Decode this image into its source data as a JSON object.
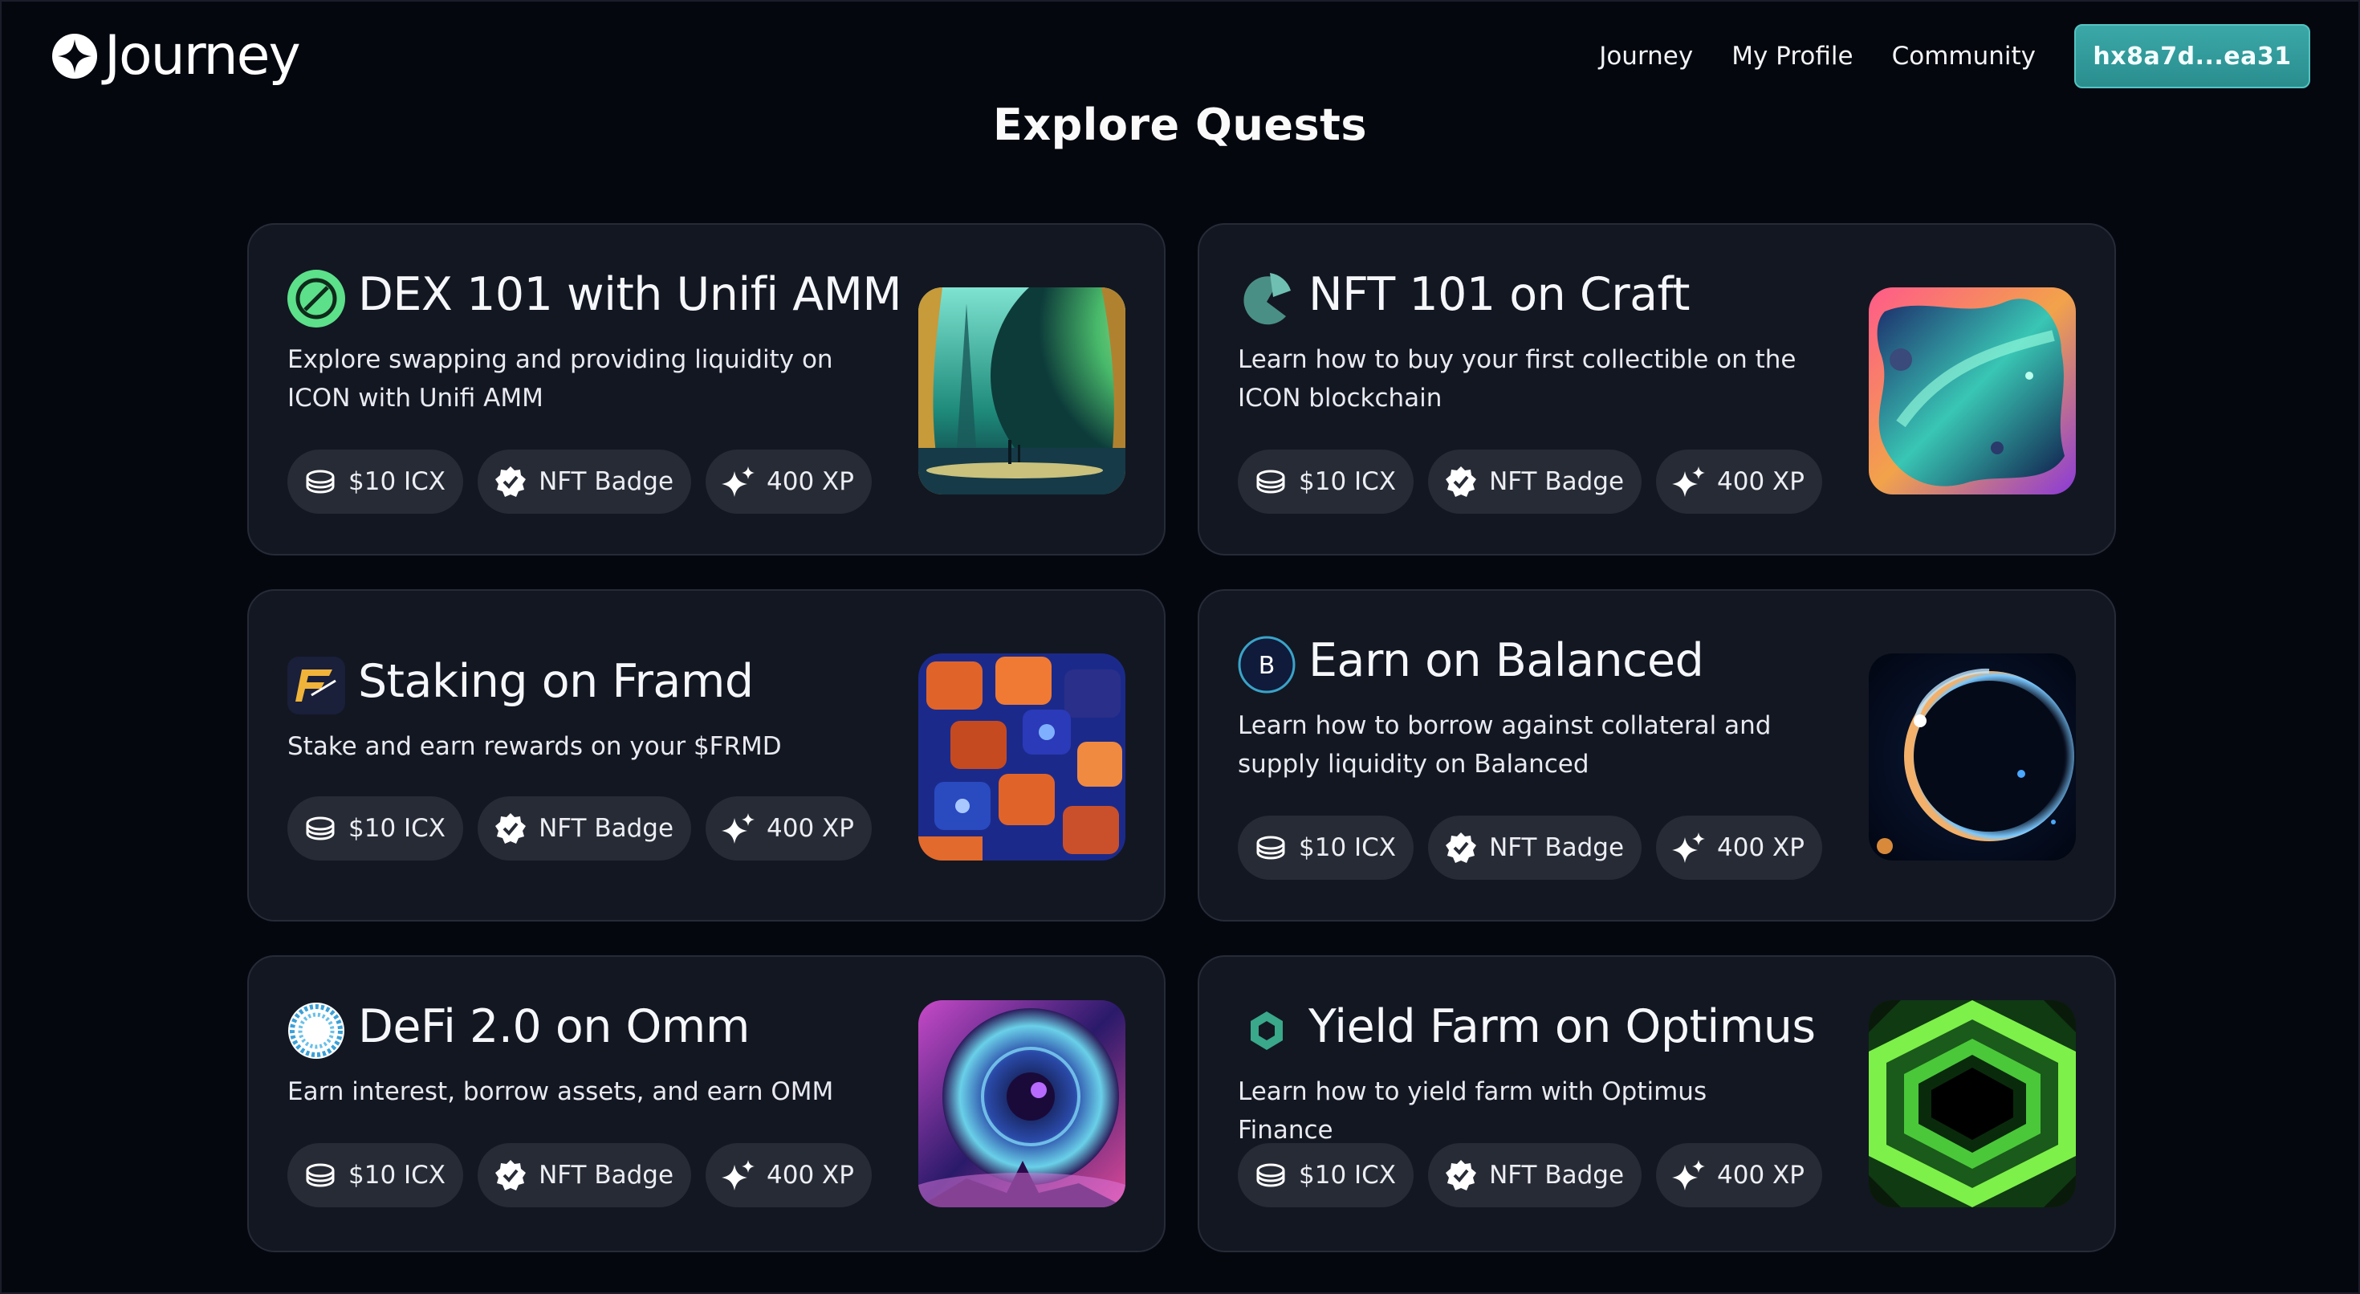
{
  "header": {
    "brand": "Journey",
    "nav": [
      "Journey",
      "My Profile",
      "Community"
    ],
    "wallet_label": "hx8a7d...ea31",
    "accent": "#2f9b9c"
  },
  "page_title": "Explore Quests",
  "reward_tags": {
    "token": "$10 ICX",
    "badge": "NFT Badge",
    "xp": "400 XP"
  },
  "quests": [
    {
      "title": "DEX 101 with Unifi AMM",
      "description": "Explore swapping and providing liquidity on ICON with Unifi AMM",
      "logo": "unifi-logo-icon",
      "rewards": [
        "$10 ICX",
        "NFT Badge",
        "400 XP"
      ]
    },
    {
      "title": "NFT 101 on Craft",
      "description": "Learn how to buy your first collectible on the ICON blockchain",
      "logo": "craft-logo-icon",
      "rewards": [
        "$10 ICX",
        "NFT Badge",
        "400 XP"
      ]
    },
    {
      "title": "Staking on Framd",
      "description": "Stake and earn rewards on your $FRMD",
      "logo": "framd-logo-icon",
      "rewards": [
        "$10 ICX",
        "NFT Badge",
        "400 XP"
      ]
    },
    {
      "title": "Earn on Balanced",
      "description": "Learn how to borrow against collateral and supply liquidity on Balanced",
      "logo": "balanced-logo-icon",
      "logo_letter": "B",
      "rewards": [
        "$10 ICX",
        "NFT Badge",
        "400 XP"
      ]
    },
    {
      "title": "DeFi 2.0 on Omm",
      "description": "Earn interest, borrow assets, and earn OMM",
      "logo": "omm-logo-icon",
      "rewards": [
        "$10 ICX",
        "NFT Badge",
        "400 XP"
      ]
    },
    {
      "title": "Yield Farm on Optimus",
      "description": "Learn how to yield farm with Optimus Finance",
      "logo": "optimus-logo-icon",
      "rewards": [
        "$10 ICX",
        "NFT Badge",
        "400 XP"
      ]
    }
  ]
}
